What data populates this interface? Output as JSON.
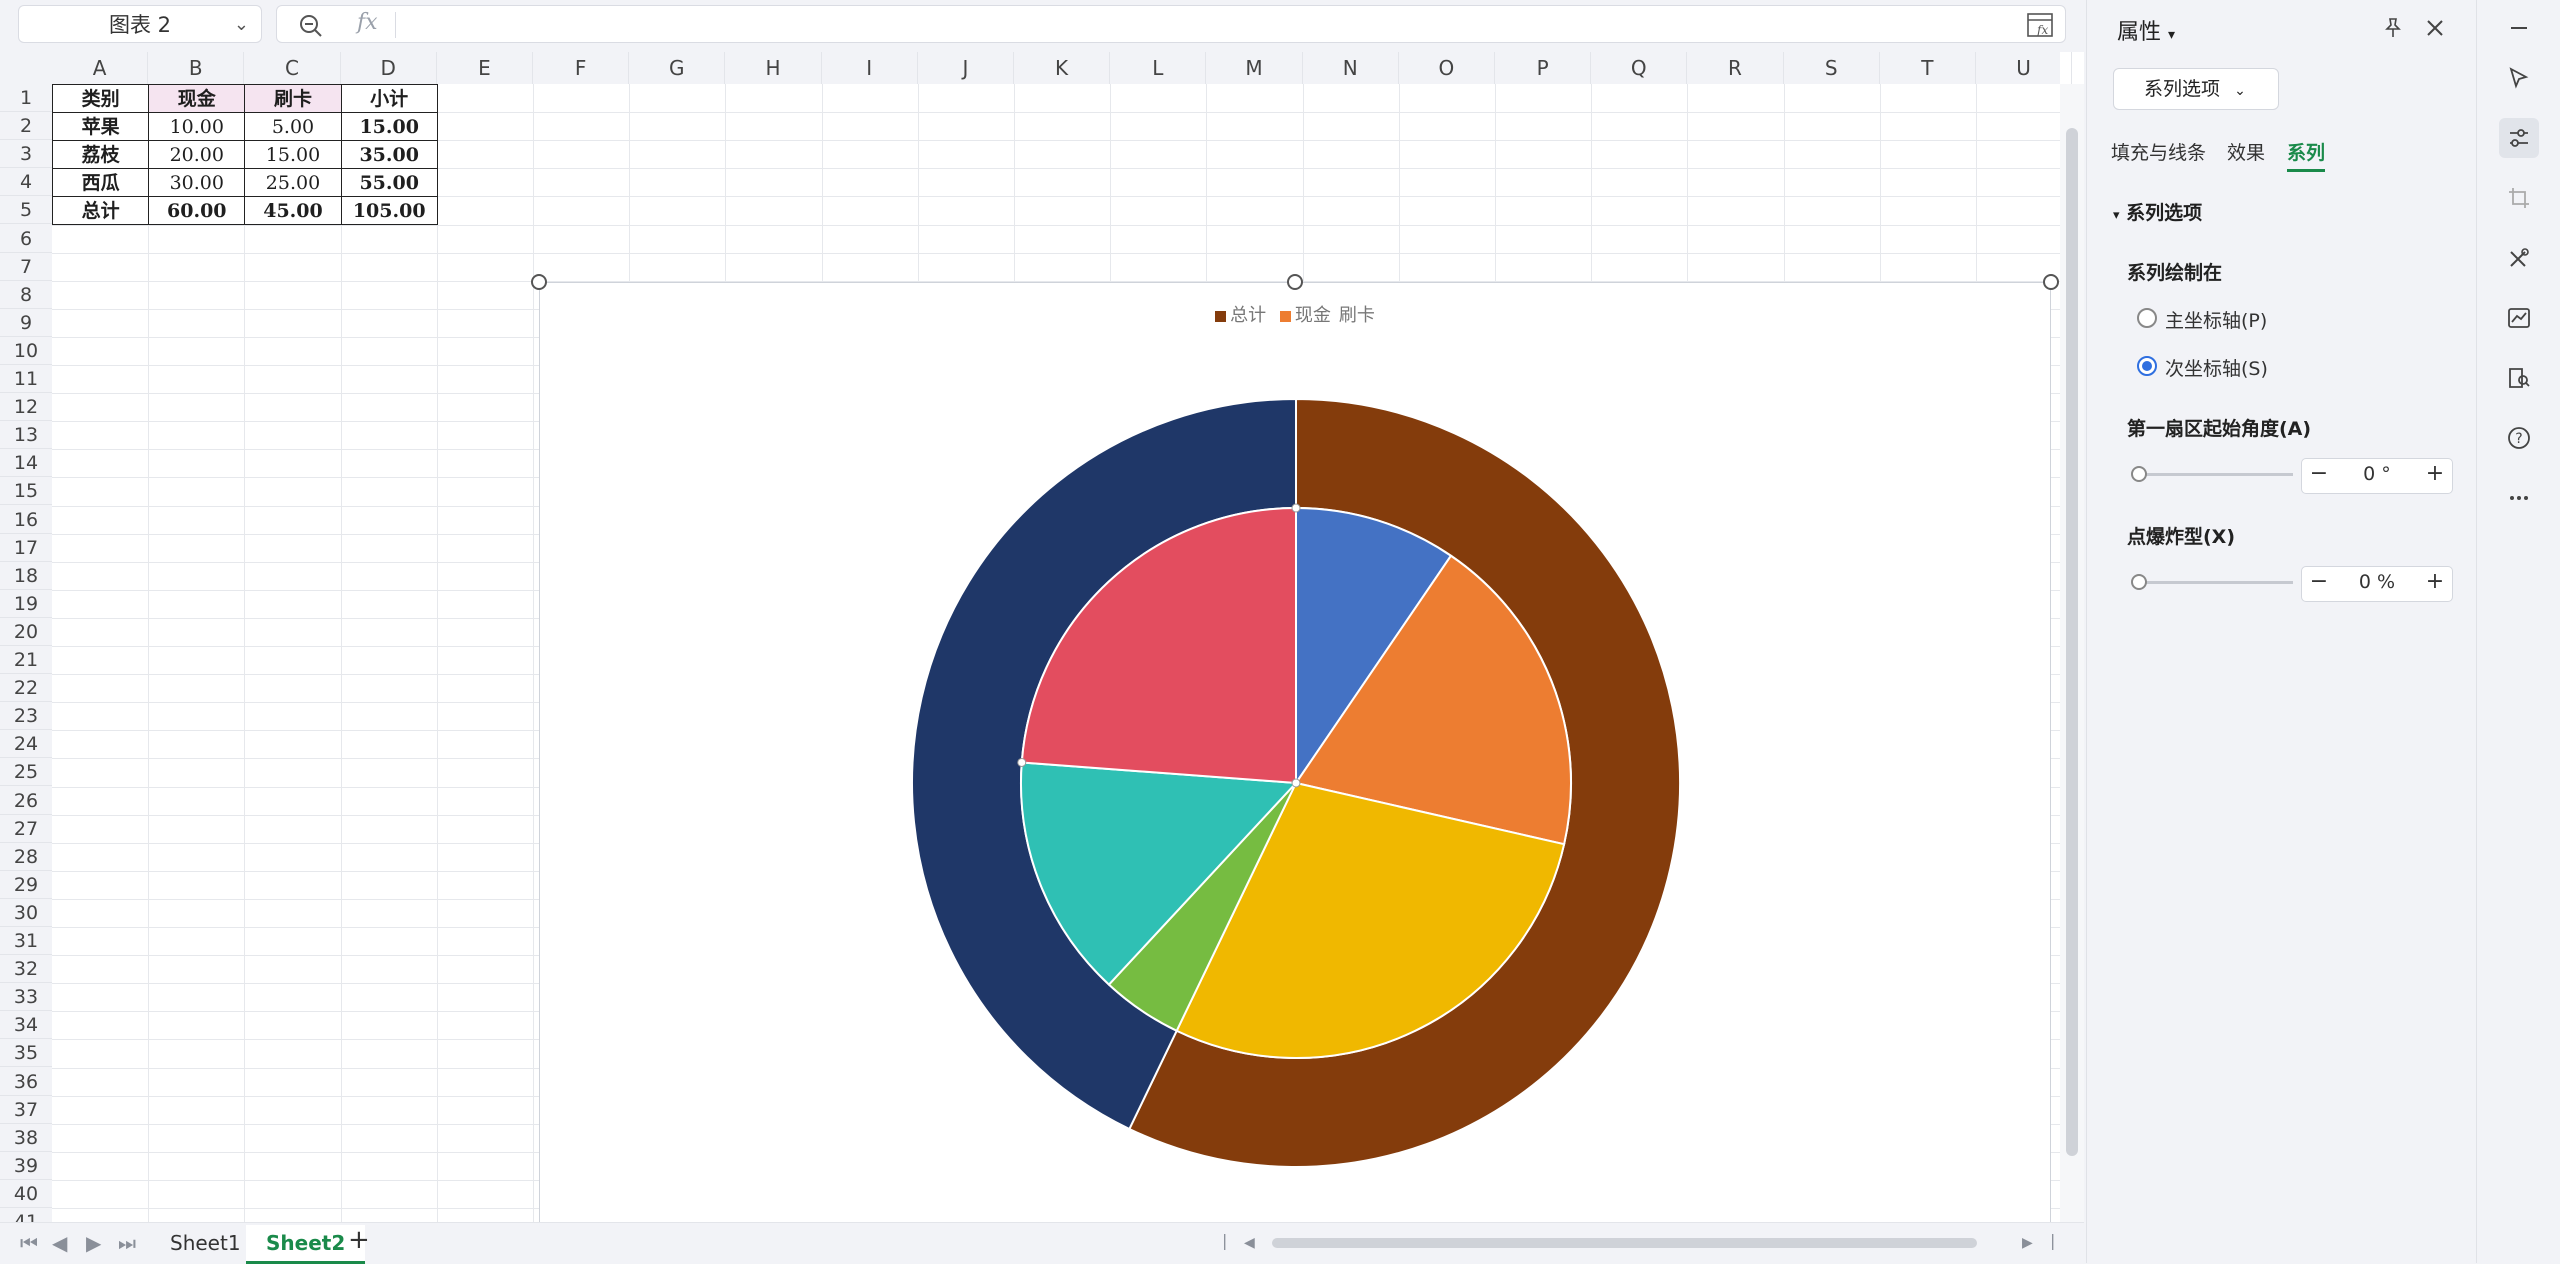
{
  "formula_bar": {
    "name_box": "图表 2",
    "fx_label": "fx",
    "formula": ""
  },
  "columns": [
    "A",
    "B",
    "C",
    "D",
    "E",
    "F",
    "G",
    "H",
    "I",
    "J",
    "K",
    "L",
    "M",
    "N",
    "O",
    "P",
    "Q",
    "R",
    "S",
    "T",
    "U"
  ],
  "rows": [
    "1",
    "2",
    "3",
    "4",
    "5",
    "6",
    "7",
    "8",
    "9",
    "10",
    "11",
    "12",
    "13",
    "14",
    "15",
    "16",
    "17",
    "18",
    "19",
    "20",
    "21",
    "22",
    "23",
    "24",
    "25",
    "26",
    "27",
    "28",
    "29",
    "30",
    "31",
    "32",
    "33",
    "34",
    "35",
    "36",
    "37",
    "38",
    "39",
    "40",
    "41"
  ],
  "table": {
    "header": [
      "类别",
      "现金",
      "刷卡",
      "小计"
    ],
    "rows": [
      [
        "苹果",
        "10.00",
        "5.00",
        "15.00"
      ],
      [
        "荔枝",
        "20.00",
        "15.00",
        "35.00"
      ],
      [
        "西瓜",
        "30.00",
        "25.00",
        "55.00"
      ],
      [
        "总计",
        "60.00",
        "45.00",
        "105.00"
      ]
    ]
  },
  "chart_data": {
    "type": "pie",
    "legend": [
      "总计",
      "现金",
      "刷卡"
    ],
    "legend_colors": [
      "#843c0c",
      "#ed7d31",
      "#ffffff"
    ],
    "series": [
      {
        "name": "inner-pie",
        "values": [
          10,
          20,
          30,
          5,
          15,
          25
        ],
        "colors": [
          "#4472c4",
          "#ed7d31",
          "#f0b800",
          "#76bc41",
          "#2fc0b4",
          "#e34d5f"
        ]
      },
      {
        "name": "outer-ring",
        "values": [
          60,
          45
        ],
        "colors": [
          "#843c0c",
          "#1f3768"
        ]
      }
    ]
  },
  "sheet_tabs": [
    {
      "label": "Sheet1",
      "active": false
    },
    {
      "label": "Sheet2",
      "active": true
    }
  ],
  "add_sheet": "+",
  "panel": {
    "title": "属性",
    "series_dropdown": "系列选项",
    "tabs": [
      "填充与线条",
      "效果",
      "系列"
    ],
    "active_tab": "系列",
    "section": "系列选项",
    "plot_on_label": "系列绘制在",
    "primary_axis": "主坐标轴(P)",
    "secondary_axis": "次坐标轴(S)",
    "first_slice_angle_label": "第一扇区起始角度(A)",
    "first_slice_angle_value": "0 °",
    "explosion_label": "点爆炸型(X)",
    "explosion_value": "0 %",
    "minus": "−",
    "plus": "+"
  }
}
